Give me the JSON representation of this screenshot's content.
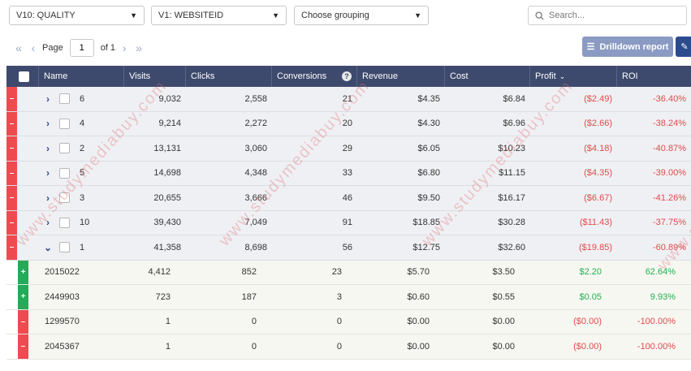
{
  "filters": {
    "level1": "V10: QUALITY",
    "level2": "V1: WEBSITEID",
    "grouping": "Choose grouping",
    "search_placeholder": "Search..."
  },
  "pager": {
    "page_label": "Page",
    "page_value": "1",
    "of_label": "of 1"
  },
  "drilldown_label": "Drilldown report",
  "columns": [
    "Name",
    "Visits",
    "Clicks",
    "Conversions",
    "Revenue",
    "Cost",
    "Profit",
    "ROI"
  ],
  "rows": [
    {
      "kind": "parent",
      "expand": "›",
      "name": "6",
      "visits": "9,032",
      "clicks": "2,558",
      "conversions": "21",
      "revenue": "$4.35",
      "cost": "$6.84",
      "profit": "($2.49)",
      "roi": "-36.40%",
      "tone": "neg"
    },
    {
      "kind": "parent",
      "expand": "›",
      "name": "4",
      "visits": "9,214",
      "clicks": "2,272",
      "conversions": "20",
      "revenue": "$4.30",
      "cost": "$6.96",
      "profit": "($2.66)",
      "roi": "-38.24%",
      "tone": "neg"
    },
    {
      "kind": "parent",
      "expand": "›",
      "name": "2",
      "visits": "13,131",
      "clicks": "3,060",
      "conversions": "29",
      "revenue": "$6.05",
      "cost": "$10.23",
      "profit": "($4.18)",
      "roi": "-40.87%",
      "tone": "neg"
    },
    {
      "kind": "parent",
      "expand": "›",
      "name": "5",
      "visits": "14,698",
      "clicks": "4,348",
      "conversions": "33",
      "revenue": "$6.80",
      "cost": "$11.15",
      "profit": "($4.35)",
      "roi": "-39.00%",
      "tone": "neg"
    },
    {
      "kind": "parent",
      "expand": "›",
      "name": "3",
      "visits": "20,655",
      "clicks": "3,666",
      "conversions": "46",
      "revenue": "$9.50",
      "cost": "$16.17",
      "profit": "($6.67)",
      "roi": "-41.26%",
      "tone": "neg"
    },
    {
      "kind": "parent",
      "expand": "›",
      "name": "10",
      "visits": "39,430",
      "clicks": "7,049",
      "conversions": "91",
      "revenue": "$18.85",
      "cost": "$30.28",
      "profit": "($11.43)",
      "roi": "-37.75%",
      "tone": "neg"
    },
    {
      "kind": "parent",
      "expand": "⌄",
      "name": "1",
      "visits": "41,358",
      "clicks": "8,698",
      "conversions": "56",
      "revenue": "$12.75",
      "cost": "$32.60",
      "profit": "($19.85)",
      "roi": "-60.89%",
      "tone": "neg"
    },
    {
      "kind": "child",
      "strip": "+",
      "name": "2015022",
      "visits": "4,412",
      "clicks": "852",
      "conversions": "23",
      "revenue": "$5.70",
      "cost": "$3.50",
      "profit": "$2.20",
      "roi": "62.64%",
      "tone": "pos"
    },
    {
      "kind": "child",
      "strip": "+",
      "name": "2449903",
      "visits": "723",
      "clicks": "187",
      "conversions": "3",
      "revenue": "$0.60",
      "cost": "$0.55",
      "profit": "$0.05",
      "roi": "9.93%",
      "tone": "pos"
    },
    {
      "kind": "child",
      "strip": "–",
      "name": "1299570",
      "visits": "1",
      "clicks": "0",
      "conversions": "0",
      "revenue": "$0.00",
      "cost": "$0.00",
      "profit": "($0.00)",
      "roi": "-100.00%",
      "tone": "neg"
    },
    {
      "kind": "child",
      "strip": "–",
      "name": "2045367",
      "visits": "1",
      "clicks": "0",
      "conversions": "0",
      "revenue": "$0.00",
      "cost": "$0.00",
      "profit": "($0.00)",
      "roi": "-100.00%",
      "tone": "neg"
    }
  ],
  "watermark": "www.studymediabuy.com",
  "colors": {
    "header_bg": "#3e4a6d",
    "negative": "#e24a4a",
    "positive": "#22b04e",
    "strip_red": "#ed4b4f",
    "strip_green": "#27a958"
  }
}
